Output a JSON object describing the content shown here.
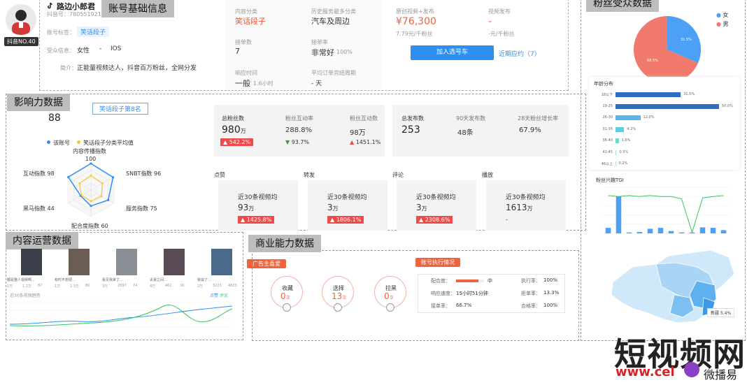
{
  "account": {
    "section_title": "账号基础信息",
    "name": "路边小郎君",
    "douyin_id": "抖音号：780551921",
    "badge": "抖音NO.40",
    "tag_label": "账号标签：",
    "tag_value": "笑话段子",
    "audience_label": "受众信息：",
    "gender": "女性",
    "sep": "-",
    "os": "IOS",
    "intro_label": "简介：",
    "intro": "正能量视频达人，抖音百万粉丝，全网分发"
  },
  "stats_mid": {
    "content_cat_label": "内容分类",
    "content_cat_value": "笑话段子",
    "hist_cat_label": "历史服务最多分类",
    "hist_cat_value": "汽车及周边",
    "orders_label": "接单数",
    "orders_value": "7",
    "accept_label": "接单率",
    "accept_value": "非常好",
    "accept_pct": "100%",
    "response_label": "响应时间",
    "response_value": "一般",
    "response_hours": "1.6小时",
    "cycle_label": "平均订单完结周期",
    "cycle_value": "- 天"
  },
  "pricing": {
    "orig_label": "原创视频+发布",
    "orig_price": "¥76,300",
    "orig_sub": "7.79元/千粉丝",
    "video_label": "视频发布",
    "video_price": "-",
    "video_sub": "-元/千粉丝",
    "add_button": "加入选号车",
    "recent_link": "近期应约（7）"
  },
  "influence": {
    "section_title": "影响力数据",
    "score": "88",
    "rank_badge": "笑话段子第8名",
    "legend_self": "该账号",
    "legend_avg": "笑话段子分类平均值",
    "radar_labels": [
      "内容传播指数",
      "SNBT指数 96",
      "服务指数 75",
      "配合度指数 60",
      "黑马指数 44",
      "互动指数 98"
    ],
    "radar_center_value": "100",
    "radar_self": [
      1.0,
      0.96,
      0.75,
      0.6,
      0.44,
      0.98
    ],
    "radar_avg": [
      0.55,
      0.5,
      0.45,
      0.42,
      0.4,
      0.5
    ]
  },
  "fans": {
    "total_label": "总粉丝数",
    "total_value": "980",
    "total_unit": "万",
    "total_growth": "542.2%",
    "interact_rate_label": "粉丝互动率",
    "interact_rate_value": "288.8%",
    "interact_rate_growth": "93.7%",
    "interact_label": "粉丝互动数",
    "interact_value": "98万",
    "interact_growth": "1451.1%",
    "works_label": "总发布数",
    "works_value": "253",
    "works90_label": "90天发布数",
    "works90_value": "48条",
    "growth28_label": "28天粉丝增长率",
    "growth28_value": "67.9%"
  },
  "engagement": {
    "cards": [
      {
        "label": "点赞",
        "sub": "近30条视频均",
        "value": "93",
        "unit": "万",
        "growth": "1425.8%"
      },
      {
        "label": "转发",
        "sub": "近30条视频均",
        "value": "3",
        "unit": "万",
        "growth": "1806.1%"
      },
      {
        "label": "评论",
        "sub": "近30条视频均",
        "value": "3",
        "unit": "万",
        "growth": "2308.6%"
      },
      {
        "label": "播放",
        "sub": "近30条视频均",
        "value": "1613",
        "unit": "万",
        "growth": "-"
      }
    ]
  },
  "content_ops": {
    "section_title": "内容运营数据",
    "videos": [
      {
        "caption": "都是整人视频啊…",
        "likes": "1万",
        "comments": "1.2万",
        "shares": "87"
      },
      {
        "caption": "有时不想把…",
        "likes": "1万",
        "comments": "2.3万",
        "shares": "80"
      },
      {
        "caption": "看见我来了…",
        "likes": "3万",
        "comments": "2897",
        "shares": "74"
      },
      {
        "caption": "夫妻之间…",
        "likes": "4万",
        "comments": "461",
        "shares": "91"
      },
      {
        "caption": "我说了…",
        "likes": "2万",
        "comments": "3223",
        "shares": "4823"
      }
    ],
    "trend_title": "近30条视频趋势",
    "legend": [
      "点赞",
      "评论"
    ]
  },
  "business": {
    "section_title": "商业能力数据",
    "ad_title": "广告主喜爱",
    "circles": [
      {
        "label": "收藏",
        "value": "0",
        "unit": "次"
      },
      {
        "label": "选择",
        "value": "13",
        "unit": "次"
      },
      {
        "label": "拉黑",
        "value": "0",
        "unit": "次"
      }
    ],
    "exec_title": "账号执行情况",
    "rows": [
      {
        "k1": "配合度：",
        "v1": "中",
        "k2": "执行率：",
        "v2": "100%"
      },
      {
        "k1": "响应速度：",
        "v1": "15小时51分钟",
        "k2": "拒单率：",
        "v2": "13.3%"
      },
      {
        "k1": "接单率：",
        "v1": "66.7%",
        "k2": "合格率：",
        "v2": "100%"
      }
    ],
    "coop_fill": 0.8
  },
  "demographics": {
    "section_title": "粉丝受众数据",
    "pie_legend": [
      "女",
      "男"
    ],
    "pie_female_pct": 31.5,
    "pie_female_label": "31.5%",
    "pie_male_label": "68.5%",
    "colors": {
      "female": "#4ca0f5",
      "male": "#f27a6c"
    },
    "age_title": "年龄分布",
    "age_bins": [
      "18以下",
      "19-25",
      "26-30",
      "31-35",
      "36-40",
      "41-45",
      "46以上"
    ],
    "age_values": [
      31.5,
      50.0,
      12.0,
      4.2,
      1.6,
      0.5,
      0.2
    ],
    "age_labels": [
      "31.5%",
      "50.0%",
      "12.0%",
      "4.2%",
      "1.6%",
      "0.5%",
      "0.2%"
    ],
    "tgi_title": "粉丝兴趣TGI",
    "tgi_bars": [
      12,
      80,
      2,
      3,
      10,
      12,
      5,
      2,
      2,
      13,
      12,
      7
    ],
    "tgi_line": [
      82,
      80,
      82,
      80,
      82,
      80,
      80,
      75,
      2,
      77,
      80,
      82
    ],
    "map_legend": "新疆",
    "map_value": "5.4%"
  },
  "watermark": {
    "cn": "短视频网",
    "url": "www.cel",
    "brand": "微播易"
  }
}
